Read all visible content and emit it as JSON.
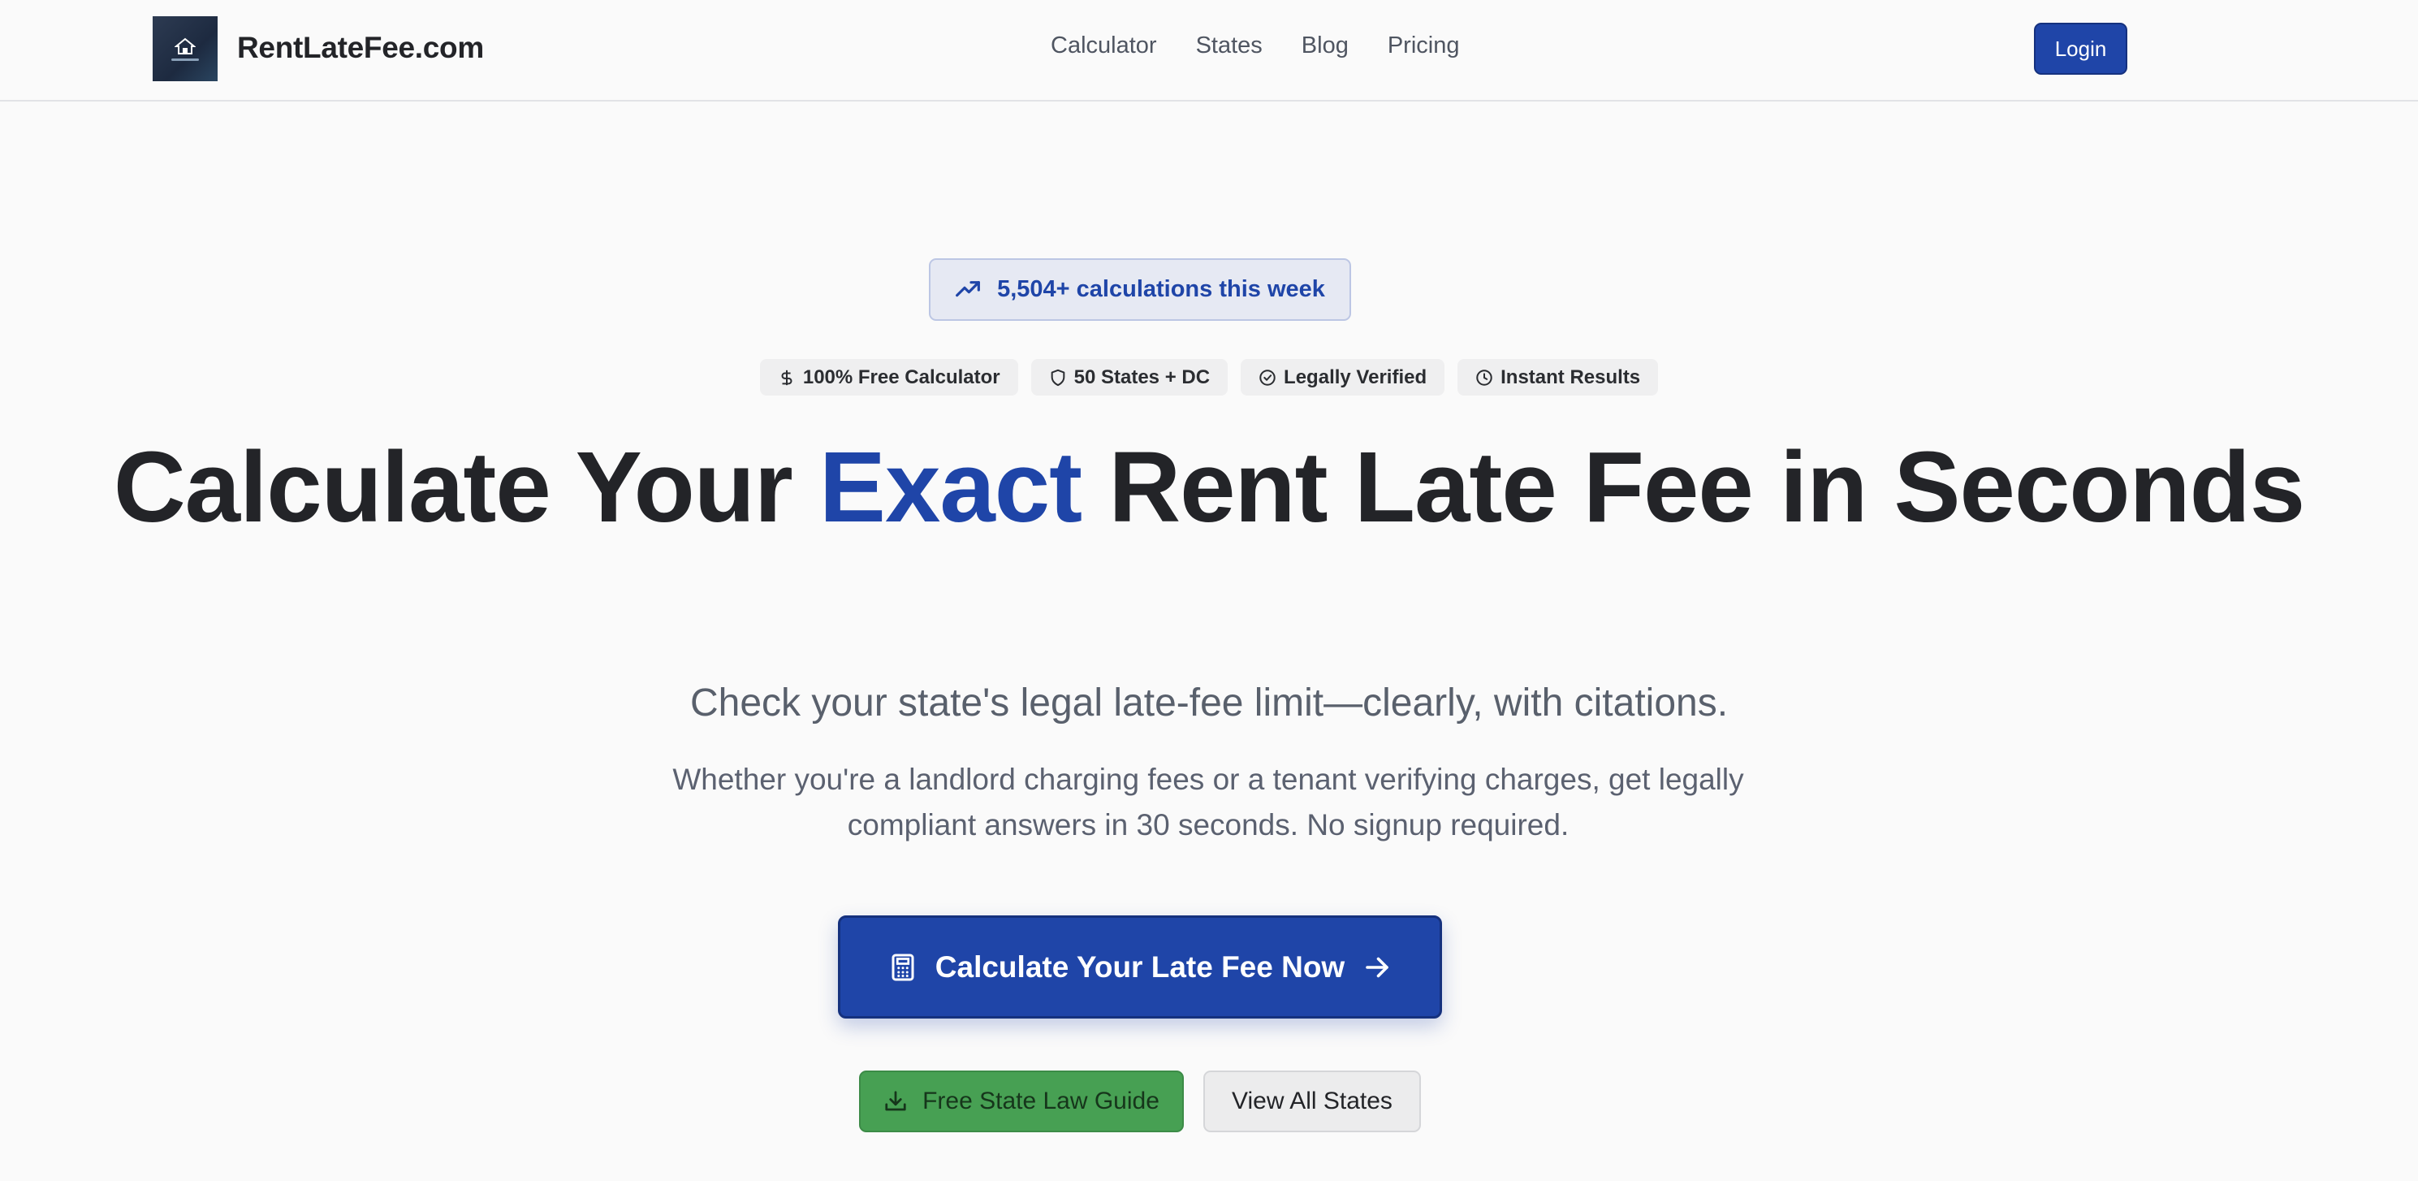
{
  "header": {
    "brand": "RentLateFee.com",
    "nav": [
      "Calculator",
      "States",
      "Blog",
      "Pricing"
    ],
    "login_label": "Login"
  },
  "hero": {
    "stats_pill": "5,504+ calculations this week",
    "badges": [
      {
        "icon": "dollar-icon",
        "label": "100% Free Calculator"
      },
      {
        "icon": "shield-icon",
        "label": "50 States + DC"
      },
      {
        "icon": "check-circle-icon",
        "label": "Legally Verified"
      },
      {
        "icon": "clock-icon",
        "label": "Instant Results"
      }
    ],
    "headline_part1": "Calculate Your ",
    "headline_accent": "Exact",
    "headline_part2": " Rent Late Fee in Seconds",
    "subheadline": "Check your state's legal late-fee limit—clearly, with citations.",
    "description": "Whether you're a landlord charging fees or a tenant verifying charges, get legally compliant answers in 30 seconds. No signup required.",
    "cta_label": "Calculate Your Late Fee Now",
    "guide_label": "Free State Law Guide",
    "view_all_label": "View All States"
  },
  "colors": {
    "accent": "#1f45a8",
    "success": "#47a053",
    "background": "#fafafa"
  }
}
